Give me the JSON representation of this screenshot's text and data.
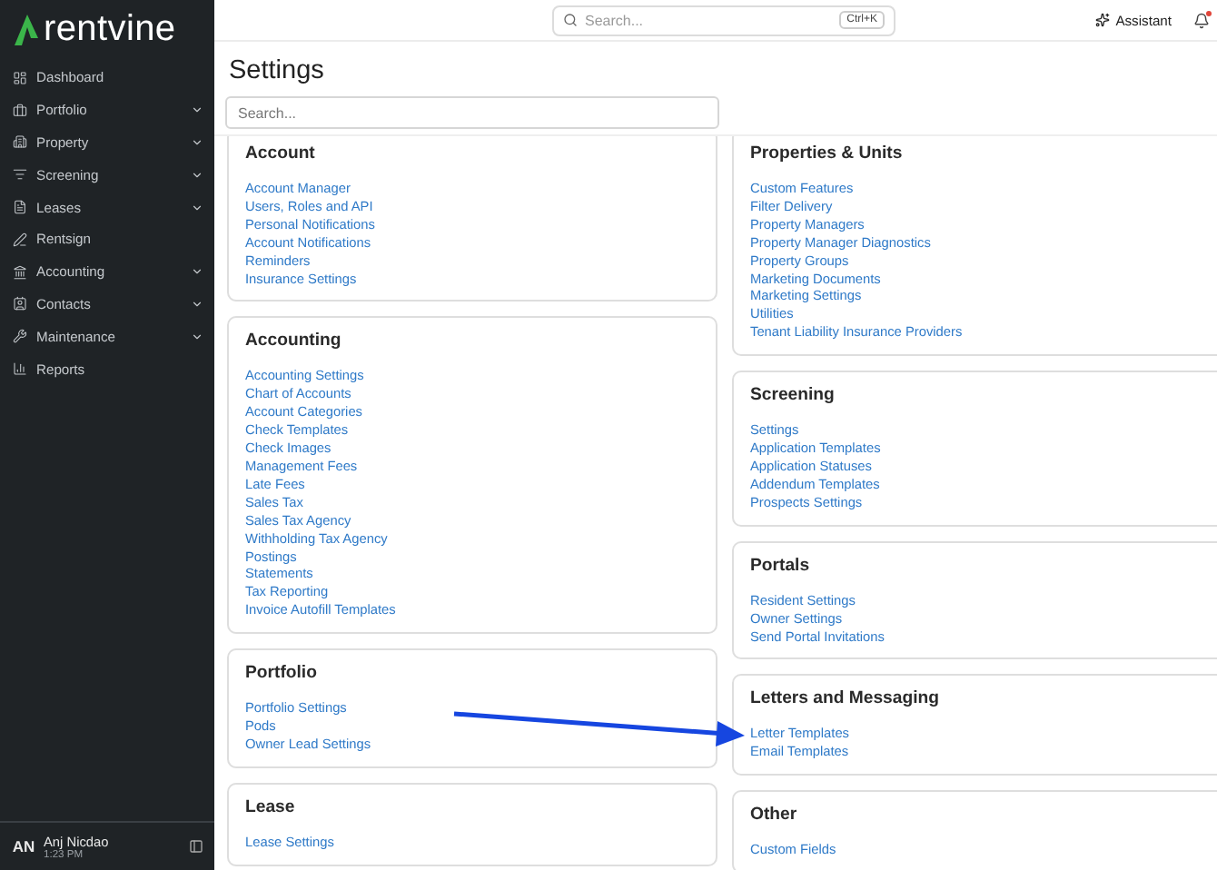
{
  "sidebar": {
    "logo": "rentvine",
    "items": [
      {
        "label": "Dashboard",
        "has_submenu": false
      },
      {
        "label": "Portfolio",
        "has_submenu": true
      },
      {
        "label": "Property",
        "has_submenu": true
      },
      {
        "label": "Screening",
        "has_submenu": true
      },
      {
        "label": "Leases",
        "has_submenu": true
      },
      {
        "label": "Rentsign",
        "has_submenu": false
      },
      {
        "label": "Accounting",
        "has_submenu": true
      },
      {
        "label": "Contacts",
        "has_submenu": true
      },
      {
        "label": "Maintenance",
        "has_submenu": true
      },
      {
        "label": "Reports",
        "has_submenu": false
      }
    ],
    "user": {
      "initials": "AN",
      "name": "Anj Nicdao",
      "time": "1:23 PM"
    }
  },
  "topbar": {
    "search": {
      "placeholder": "Search...",
      "shortcut": "Ctrl+K"
    },
    "assistant": "Assistant",
    "notifications": true
  },
  "page": {
    "title": "Settings",
    "search": {
      "placeholder": "Search..."
    }
  },
  "columns": [
    [
      {
        "title": "Account",
        "links": [
          "Account Manager",
          "Users, Roles and API",
          "Personal Notifications",
          "Account Notifications",
          "Reminders",
          "Insurance Settings"
        ]
      },
      {
        "title": "Accounting",
        "links": [
          "Accounting Settings",
          "Chart of Accounts",
          "Account Categories",
          "Check Templates",
          "Check Images",
          "Management Fees",
          "Late Fees",
          "Sales Tax",
          "Sales Tax Agency",
          "Withholding Tax Agency",
          "Postings",
          "Statements",
          "Tax Reporting",
          "Invoice Autofill Templates"
        ]
      },
      {
        "title": "Portfolio",
        "links": [
          "Portfolio Settings",
          "Pods",
          "Owner Lead Settings"
        ]
      },
      {
        "title": "Lease",
        "links": [
          "Lease Settings"
        ]
      }
    ],
    [
      {
        "title": "Properties & Units",
        "links": [
          "Custom Features",
          "Filter Delivery",
          "Property Managers",
          "Property Manager Diagnostics",
          "Property Groups",
          "Marketing Documents",
          "Marketing Settings",
          "Utilities",
          "Tenant Liability Insurance Providers"
        ]
      },
      {
        "title": "Screening",
        "links": [
          "Settings",
          "Application Templates",
          "Application Statuses",
          "Addendum Templates",
          "Prospects Settings"
        ]
      },
      {
        "title": "Portals",
        "links": [
          "Resident Settings",
          "Owner Settings",
          "Send Portal Invitations"
        ]
      },
      {
        "title": "Letters and Messaging",
        "links": [
          "Letter Templates",
          "Email Templates"
        ]
      },
      {
        "title": "Other",
        "links": [
          "Custom Fields"
        ]
      }
    ]
  ]
}
